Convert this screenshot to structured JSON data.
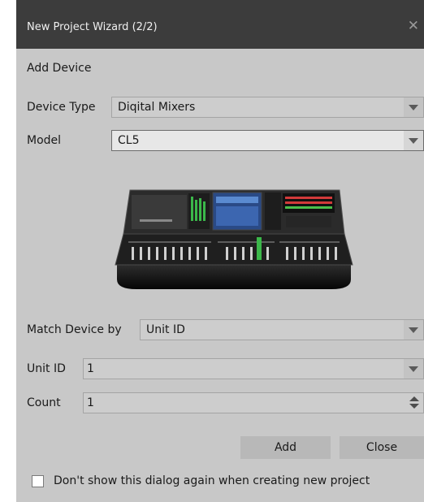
{
  "window": {
    "title": "New Project Wizard (2/2)"
  },
  "section": {
    "heading": "Add Device"
  },
  "form": {
    "device_type": {
      "label": "Device Type",
      "value": "Diqital Mixers"
    },
    "model": {
      "label": "Model",
      "value": "CL5"
    },
    "match_device": {
      "label": "Match Device by",
      "value": "Unit ID"
    },
    "unit_id": {
      "label": "Unit ID",
      "value": "1"
    },
    "count": {
      "label": "Count",
      "value": "1"
    }
  },
  "buttons": {
    "add": "Add",
    "close": "Close"
  },
  "footer": {
    "checkbox_label": "Don't show this dialog again when creating new project",
    "checked": false
  },
  "colors": {
    "titlebar": "#3c3c3c",
    "dialog_bg": "#c8c8c8",
    "field_bg": "#cdcdcd",
    "button_bg": "#b8b8b8"
  },
  "icons": {
    "close": "close-icon",
    "dropdown": "chevron-down-icon",
    "spinner": "spinner-arrows-icon",
    "device": "digital-mixer-console-image"
  }
}
